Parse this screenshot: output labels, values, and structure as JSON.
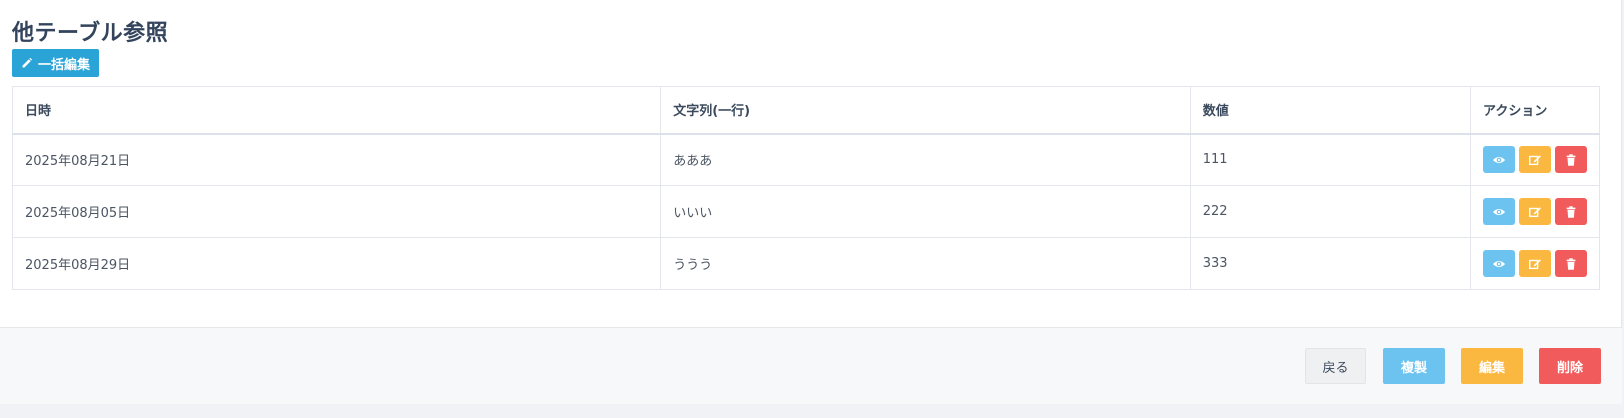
{
  "page": {
    "title": "他テーブル参照",
    "bulk_edit_label": "一括編集"
  },
  "table": {
    "headers": [
      "日時",
      "文字列(一行)",
      "数値",
      "アクション"
    ],
    "rows": [
      {
        "date": "2025年08月21日",
        "text": "あああ",
        "number": "111"
      },
      {
        "date": "2025年08月05日",
        "text": "いいい",
        "number": "222"
      },
      {
        "date": "2025年08月29日",
        "text": "ううう",
        "number": "333"
      }
    ],
    "row_actions": [
      "eye-icon",
      "edit-icon",
      "trash-icon"
    ]
  },
  "footer": {
    "back_label": "戻る",
    "copy_label": "複製",
    "edit_label": "編集",
    "delete_label": "削除"
  },
  "colors": {
    "primary": "#2aa3d6",
    "info": "#6cc3ef",
    "warning": "#fbb840",
    "danger": "#f25b5b"
  }
}
